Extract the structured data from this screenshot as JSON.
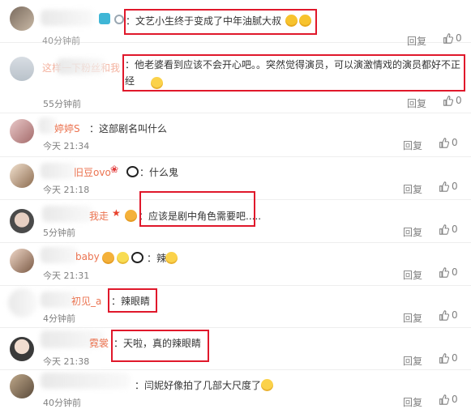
{
  "comments": [
    {
      "user": "",
      "text": "：文艺小生终于变成了中年油腻大叔",
      "time": "40分钟前",
      "reply": "回复",
      "likes": "0"
    },
    {
      "user": "这样一下粉丝和我",
      "text": "：他老婆看到应该不会开心吧。。突然觉得演员，可以演激情戏的演员都好不正经",
      "time": "55分钟前",
      "reply": "回复",
      "likes": "0"
    },
    {
      "user": "婷婷S",
      "text": "：这部剧名叫什么",
      "time": "今天 21:34",
      "reply": "回复",
      "likes": "0"
    },
    {
      "user": "旧豆ovo",
      "text": "：什么鬼",
      "time": "今天 21:18",
      "reply": "回复",
      "likes": "0"
    },
    {
      "user": "我走",
      "text": "：应该是剧中角色需要吧.....",
      "time": "5分钟前",
      "reply": "回复",
      "likes": "0"
    },
    {
      "user": "baby",
      "text": "：辣",
      "time": "今天 21:31",
      "reply": "回复",
      "likes": "0"
    },
    {
      "user": "初见_a",
      "text": "：辣眼睛",
      "time": "4分钟前",
      "reply": "回复",
      "likes": "0"
    },
    {
      "user": "霓裳",
      "text": "：天啦，真的辣眼睛",
      "time": "今天 21:38",
      "reply": "回复",
      "likes": "0"
    },
    {
      "user": "",
      "text": "：闫妮好像拍了几部大尺度了",
      "time": "40分钟前",
      "reply": "回复",
      "likes": "0"
    }
  ],
  "colors": {
    "accent": "#eb7350",
    "highlight_box": "#e0182b",
    "meta": "#808080"
  }
}
